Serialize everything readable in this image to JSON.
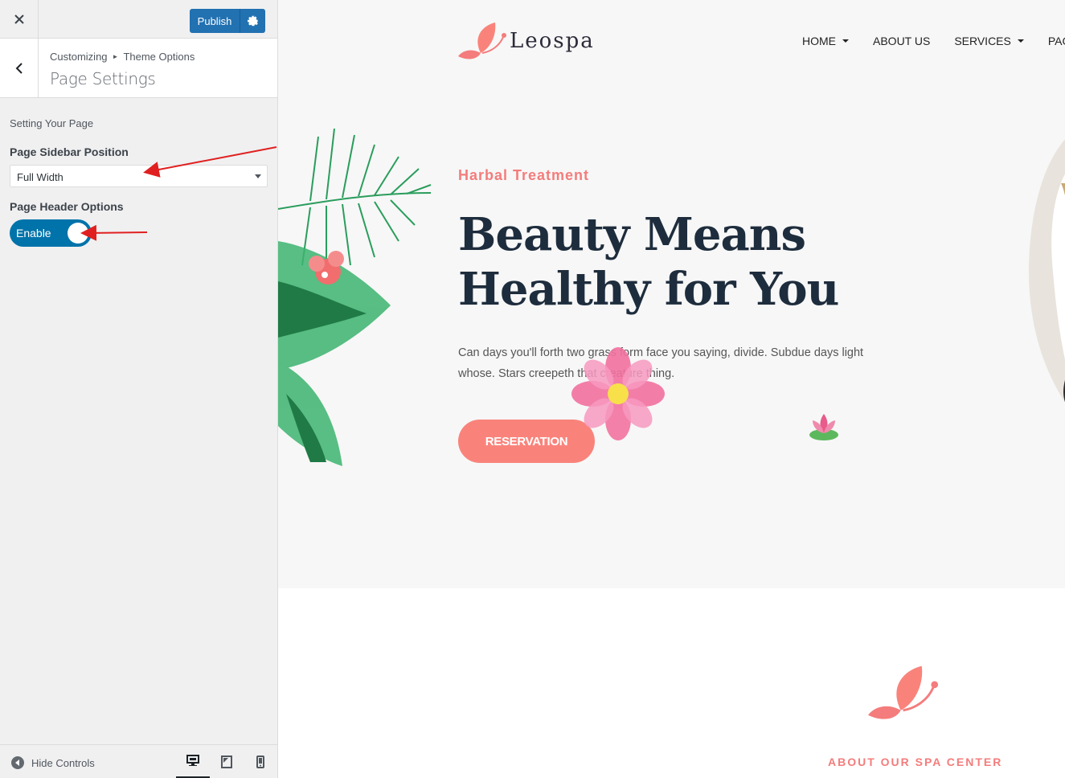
{
  "customizer": {
    "close_label": "Close",
    "publish_label": "Publish",
    "breadcrumb": {
      "root": "Customizing",
      "parent": "Theme Options"
    },
    "section_title": "Page Settings",
    "description": "Setting Your Page",
    "controls": {
      "sidebar_position": {
        "label": "Page Sidebar Position",
        "value": "Full Width"
      },
      "header_options": {
        "label": "Page Header Options",
        "value": "Enable",
        "enabled": true
      }
    },
    "footer": {
      "hide_controls_label": "Hide Controls",
      "devices": [
        "desktop",
        "tablet",
        "mobile"
      ],
      "active_device": "desktop"
    }
  },
  "site": {
    "logo_text": "Leospa",
    "nav": [
      {
        "label": "HOME",
        "dropdown": true
      },
      {
        "label": "ABOUT US",
        "dropdown": false
      },
      {
        "label": "SERVICES",
        "dropdown": true
      },
      {
        "label": "PAGE",
        "dropdown": false
      }
    ],
    "hero": {
      "eyebrow": "Harbal Treatment",
      "headline_line1": "Beauty Means",
      "headline_line2": "Healthy for You",
      "body": "Can days you'll forth two grass form face you saying, divide. Subdue days light whose. Stars creepeth that creature thing.",
      "cta": "RESERVATION"
    },
    "about_label": "ABOUT OUR SPA CENTER"
  },
  "colors": {
    "accent": "#f47c7c",
    "button": "#f9837b",
    "publish": "#2271b1",
    "toggle": "#0073aa",
    "annotation_arrow": "#e02020"
  },
  "icons": [
    "close-icon",
    "gear-icon",
    "chevron-left-icon",
    "chevron-down-icon",
    "hide-controls-icon",
    "desktop-icon",
    "tablet-icon",
    "mobile-icon",
    "butterfly-logo-icon",
    "lotus-icon"
  ]
}
